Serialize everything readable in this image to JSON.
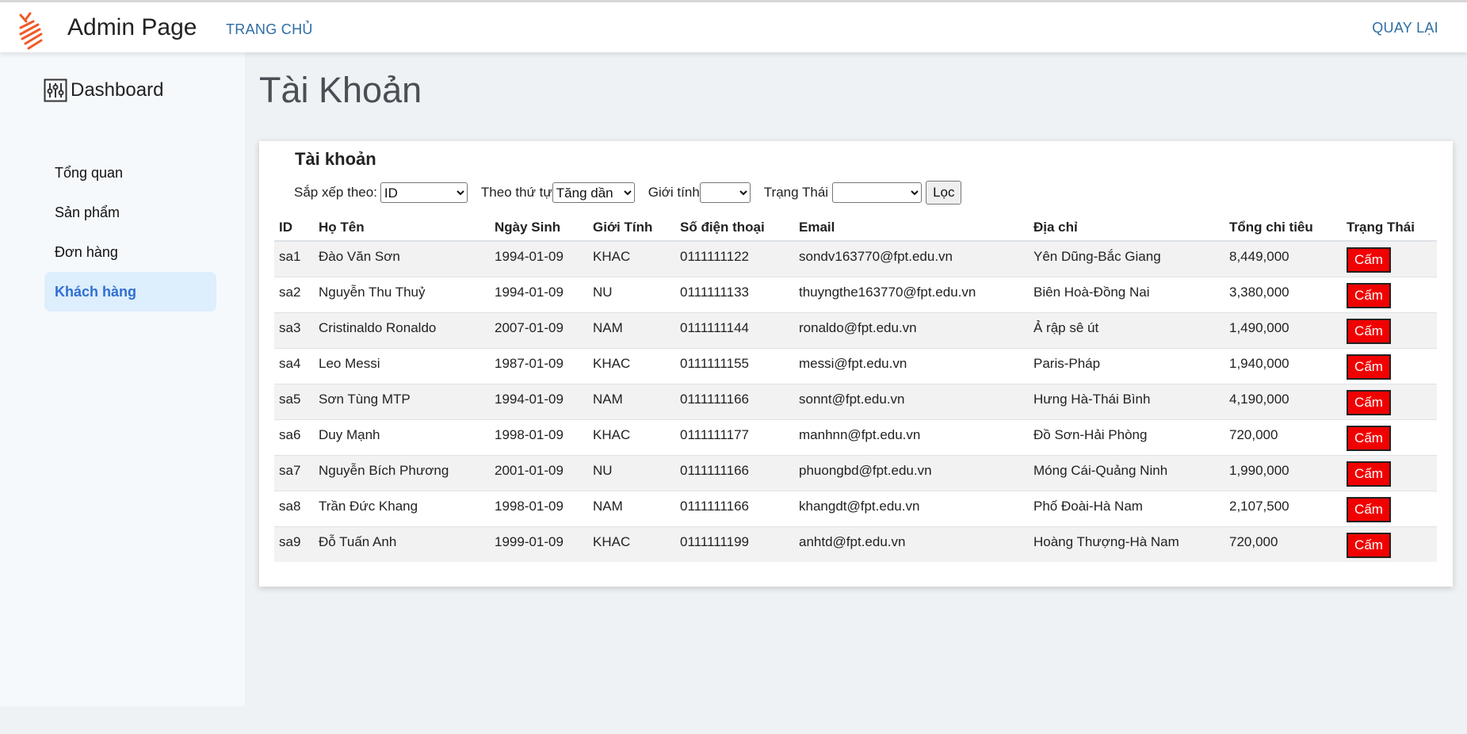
{
  "header": {
    "brand": "Admin Page",
    "nav_home": "TRANG CHỦ",
    "nav_back": "QUAY LẠI",
    "logo_icon": "striped-logo-icon"
  },
  "sidebar": {
    "title": "Dashboard",
    "title_icon": "sliders-icon",
    "items": [
      {
        "label": "Tổng quan",
        "active": false
      },
      {
        "label": "Sản phẩm",
        "active": false
      },
      {
        "label": "Đơn hàng",
        "active": false
      },
      {
        "label": "Khách hàng",
        "active": true
      }
    ]
  },
  "main": {
    "page_title": "Tài Khoản",
    "card_title": "Tài khoản",
    "filters": {
      "sort_by_label": "Sắp xếp theo:",
      "sort_by_value": "ID",
      "order_label": "Theo thứ tự",
      "order_value": "Tăng dần",
      "gender_label": "Giới tính",
      "gender_value": "",
      "status_label": "Trạng Thái",
      "status_value": "",
      "filter_button": "Lọc"
    },
    "table": {
      "columns": [
        "ID",
        "Họ Tên",
        "Ngày Sinh",
        "Giới Tính",
        "Số điện thoại",
        "Email",
        "Địa chỉ",
        "Tổng chi tiêu",
        "Trạng Thái"
      ],
      "rows": [
        {
          "id": "sa1",
          "name": "Đào Văn Sơn",
          "dob": "1994-01-09",
          "gender": "KHAC",
          "phone": "0111111122",
          "email": "sondv163770@fpt.edu.vn",
          "address": "Yên Dũng-Bắc Giang",
          "spend": "8,449,000",
          "action": "Cấm"
        },
        {
          "id": "sa2",
          "name": "Nguyễn Thu Thuỷ",
          "dob": "1994-01-09",
          "gender": "NU",
          "phone": "0111111133",
          "email": "thuyngthe163770@fpt.edu.vn",
          "address": "Biên Hoà-Đồng Nai",
          "spend": "3,380,000",
          "action": "Cấm"
        },
        {
          "id": "sa3",
          "name": "Cristinaldo Ronaldo",
          "dob": "2007-01-09",
          "gender": "NAM",
          "phone": "0111111144",
          "email": "ronaldo@fpt.edu.vn",
          "address": "Ả rập sê út",
          "spend": "1,490,000",
          "action": "Cấm"
        },
        {
          "id": "sa4",
          "name": "Leo Messi",
          "dob": "1987-01-09",
          "gender": "KHAC",
          "phone": "0111111155",
          "email": "messi@fpt.edu.vn",
          "address": "Paris-Pháp",
          "spend": "1,940,000",
          "action": "Cấm"
        },
        {
          "id": "sa5",
          "name": "Sơn Tùng MTP",
          "dob": "1994-01-09",
          "gender": "NAM",
          "phone": "0111111166",
          "email": "sonnt@fpt.edu.vn",
          "address": "Hưng Hà-Thái Bình",
          "spend": "4,190,000",
          "action": "Cấm"
        },
        {
          "id": "sa6",
          "name": "Duy Mạnh",
          "dob": "1998-01-09",
          "gender": "KHAC",
          "phone": "0111111177",
          "email": "manhnn@fpt.edu.vn",
          "address": "Đồ Sơn-Hải Phòng",
          "spend": "720,000",
          "action": "Cấm"
        },
        {
          "id": "sa7",
          "name": "Nguyễn Bích Phương",
          "dob": "2001-01-09",
          "gender": "NU",
          "phone": "0111111166",
          "email": "phuongbd@fpt.edu.vn",
          "address": "Móng Cái-Quảng Ninh",
          "spend": "1,990,000",
          "action": "Cấm"
        },
        {
          "id": "sa8",
          "name": "Trần Đức Khang",
          "dob": "1998-01-09",
          "gender": "NAM",
          "phone": "0111111166",
          "email": "khangdt@fpt.edu.vn",
          "address": "Phố Đoài-Hà Nam",
          "spend": "2,107,500",
          "action": "Cấm"
        },
        {
          "id": "sa9",
          "name": "Đỗ Tuấn Anh",
          "dob": "1999-01-09",
          "gender": "KHAC",
          "phone": "0111111199",
          "email": "anhtd@fpt.edu.vn",
          "address": "Hoàng Thượng-Hà Nam",
          "spend": "720,000",
          "action": "Cấm"
        }
      ]
    }
  },
  "colors": {
    "link": "#2e6da4",
    "active_menu_bg": "#ddeefd",
    "active_menu_text": "#2f6fd1",
    "ban_button": "#f10000",
    "logo": "#f05a28"
  }
}
